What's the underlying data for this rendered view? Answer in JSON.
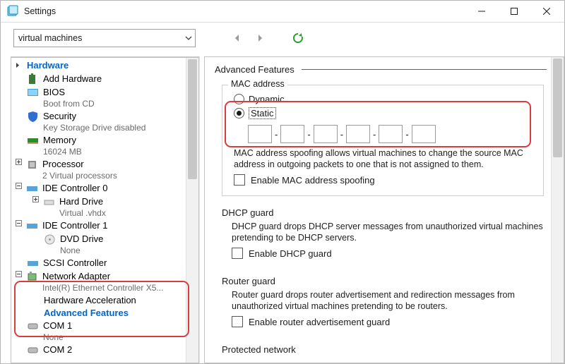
{
  "window": {
    "title": "Settings"
  },
  "toolbar": {
    "dropdown_value": "virtual machines"
  },
  "left": {
    "section_hardware": "Hardware",
    "items": {
      "add_hw": "Add Hardware",
      "bios": "BIOS",
      "bios_sub": "Boot from CD",
      "security": "Security",
      "security_sub": "Key Storage Drive disabled",
      "memory": "Memory",
      "memory_sub": "16024 MB",
      "processor": "Processor",
      "processor_sub": "2 Virtual processors",
      "ide0": "IDE Controller 0",
      "hard_drive": "Hard Drive",
      "hard_drive_sub": "Virtual .vhdx",
      "ide1": "IDE Controller 1",
      "dvd": "DVD Drive",
      "dvd_sub": "None",
      "scsi": "SCSI Controller",
      "nic": "Network Adapter",
      "nic_sub": "Intel(R) Ethernet Controller X5...",
      "hw_accel": "Hardware Acceleration",
      "adv_feat": "Advanced Features",
      "com1": "COM 1",
      "com1_sub": "None",
      "com2": "COM 2"
    }
  },
  "right": {
    "title": "Advanced Features",
    "mac_group": "MAC address",
    "dynamic": "Dynamic",
    "static": "Static",
    "spoof_text": "MAC address spoofing allows virtual machines to change the source MAC address in outgoing packets to one that is not assigned to them.",
    "spoof_chk": "Enable MAC address spoofing",
    "dhcp_title": "DHCP guard",
    "dhcp_text": "DHCP guard drops DHCP server messages from unauthorized virtual machines pretending to be DHCP servers.",
    "dhcp_chk": "Enable DHCP guard",
    "router_title": "Router guard",
    "router_text": "Router guard drops router advertisement and redirection messages from unauthorized virtual machines pretending to be routers.",
    "router_chk": "Enable router advertisement guard",
    "protected_title": "Protected network"
  }
}
